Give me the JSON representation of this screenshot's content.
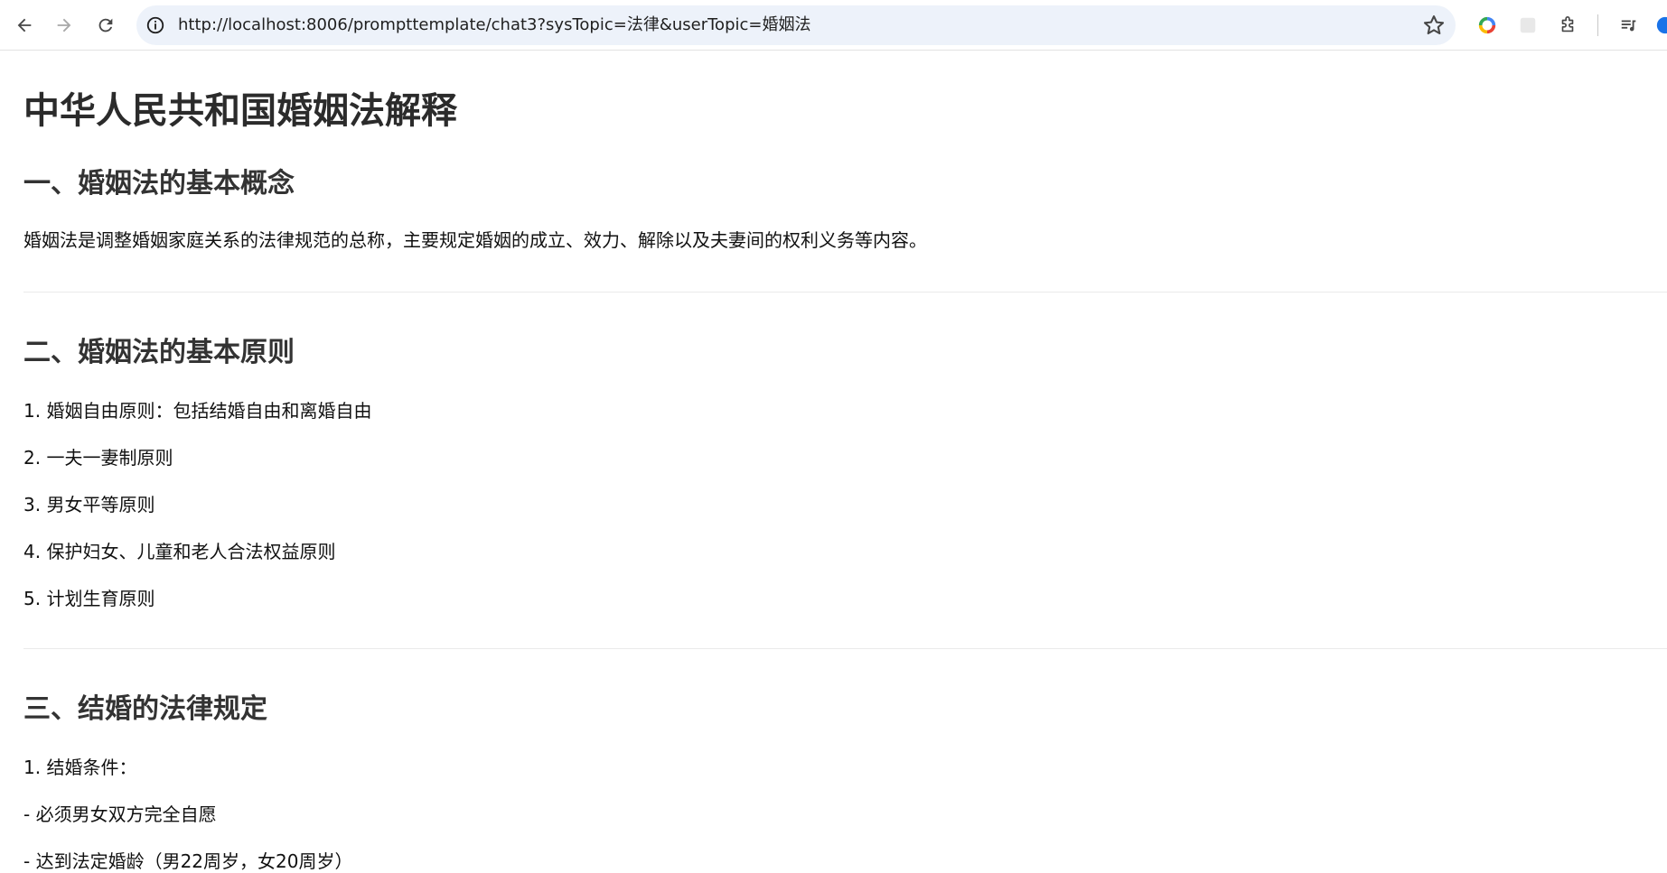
{
  "browser": {
    "url": "http://localhost:8006/prompttemplate/chat3?sysTopic=法律&userTopic=婚姻法",
    "colors": {
      "omnibox_bg": "#edf2fa",
      "divider": "#e3e3e3"
    }
  },
  "document": {
    "title": "中华人民共和国婚姻法解释",
    "sections": [
      {
        "heading": "一、婚姻法的基本概念",
        "lines": [
          "婚姻法是调整婚姻家庭关系的法律规范的总称，主要规定婚姻的成立、效力、解除以及夫妻间的权利义务等内容。"
        ]
      },
      {
        "heading": "二、婚姻法的基本原则",
        "lines": [
          "1. 婚姻自由原则：包括结婚自由和离婚自由",
          "2. 一夫一妻制原则",
          "3. 男女平等原则",
          "4. 保护妇女、儿童和老人合法权益原则",
          "5. 计划生育原则"
        ]
      },
      {
        "heading": "三、结婚的法律规定",
        "lines": [
          "1. 结婚条件：",
          "- 必须男女双方完全自愿",
          "- 达到法定婚龄（男22周岁，女20周岁）"
        ]
      }
    ]
  }
}
